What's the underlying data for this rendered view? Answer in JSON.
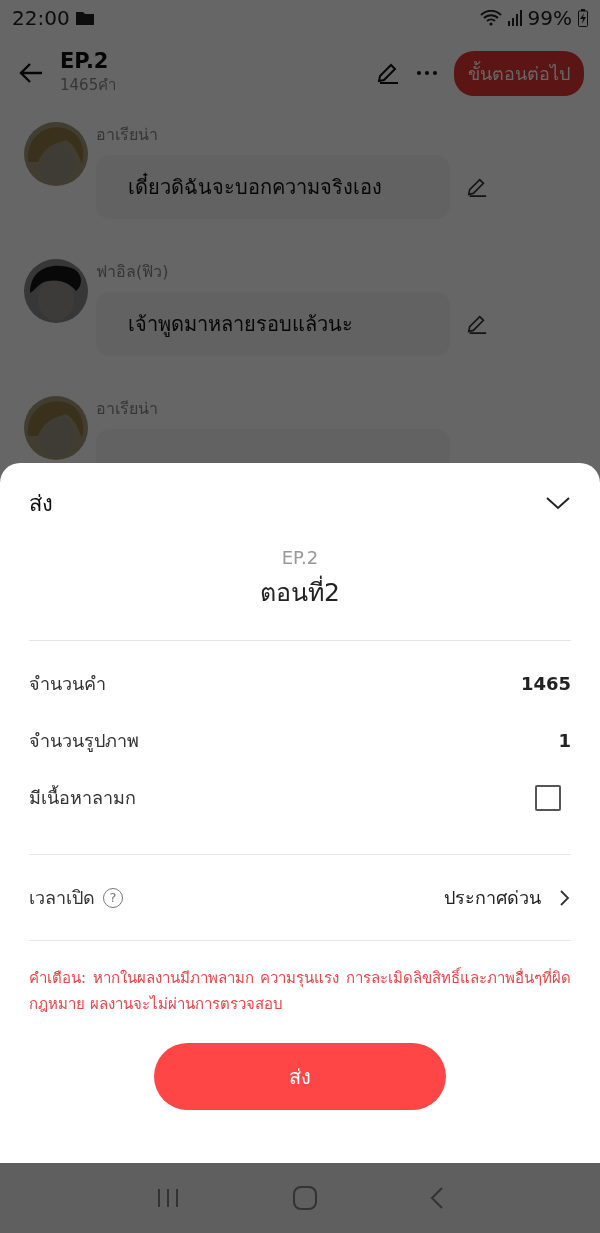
{
  "status_bar": {
    "time": "22:00",
    "battery": "99%"
  },
  "header": {
    "title": "EP.2",
    "subtitle": "1465คำ",
    "next_button": "ขั้นตอนต่อไป"
  },
  "messages": [
    {
      "author": "อาเรียน่า",
      "text": "เดี๋ยวดิฉันจะบอกความจริงเอง",
      "kind": "light"
    },
    {
      "author": "ฟาอิล(ฟิว)",
      "text": "เจ้าพูดมาหลายรอบแล้วนะ",
      "kind": "dark"
    },
    {
      "author": "อาเรียน่า",
      "kind": "light"
    }
  ],
  "sheet": {
    "title": "ส่ง",
    "episode": "EP.2",
    "episode_title": "ตอนที่2",
    "rows": [
      {
        "kind": "value",
        "label": "จำนวนคำ",
        "value": "1465"
      },
      {
        "kind": "value",
        "label": "จำนวนรูปภาพ",
        "value": "1"
      },
      {
        "kind": "checkbox",
        "label": "มีเนื้อหาลามก",
        "checked": false
      }
    ],
    "schedule": {
      "label": "เวลาเปิด",
      "help": "?",
      "value": "ประกาศด่วน"
    },
    "warning": "คำเตือน: หากในผลงานมีภาพลามก ความรุนแรง การละเมิดลิขสิทธิ์และภาพอื่นๆที่ผิดกฎหมาย ผลงานจะไม่ผ่านการตรวจสอบ",
    "submit": "ส่ง"
  }
}
